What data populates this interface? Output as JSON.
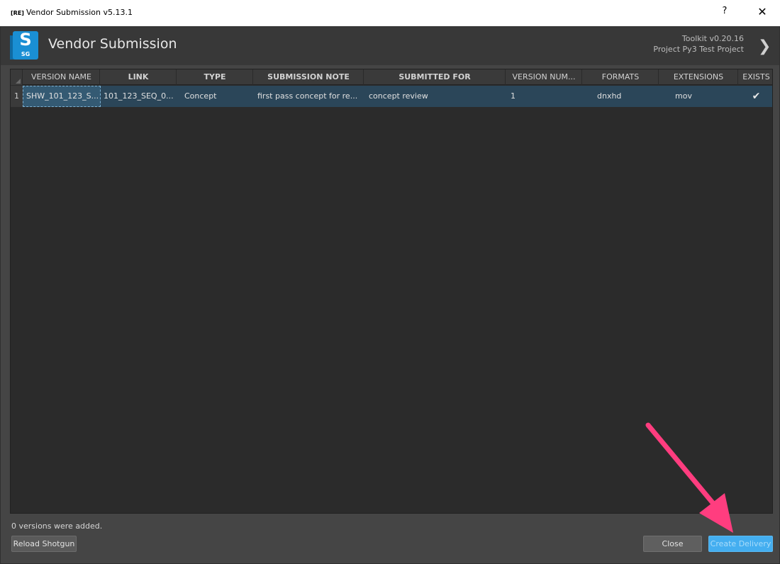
{
  "window": {
    "title_badge": "[RE]",
    "title": "Vendor Submission v5.13.1",
    "help_glyph": "?",
    "close_glyph": "✕"
  },
  "header": {
    "logo_letter": "S",
    "logo_sub": "SG",
    "app_title": "Vendor Submission",
    "toolkit_version": "Toolkit v0.20.16",
    "project": "Project Py3 Test Project",
    "chevron_glyph": "❯"
  },
  "table": {
    "columns": [
      "VERSION NAME",
      "LINK",
      "TYPE",
      "SUBMISSION NOTE",
      "SUBMITTED FOR",
      "VERSION NUM...",
      "FORMATS",
      "EXTENSIONS",
      "EXISTS"
    ],
    "rows": [
      {
        "num": "1",
        "version_name": "SHW_101_123_S...",
        "link": "101_123_SEQ_0...",
        "type": "Concept",
        "submission_note": "first pass concept for re...",
        "submitted_for": "concept review",
        "version_number": "1",
        "formats": "dnxhd",
        "extensions": "mov",
        "exists": "✔"
      }
    ]
  },
  "footer": {
    "status": "0 versions were added.",
    "reload_label": "Reload Shotgun",
    "close_label": "Close",
    "create_label": "Create Delivery"
  },
  "annotation": {
    "arrow_color": "#ff3d7f"
  }
}
